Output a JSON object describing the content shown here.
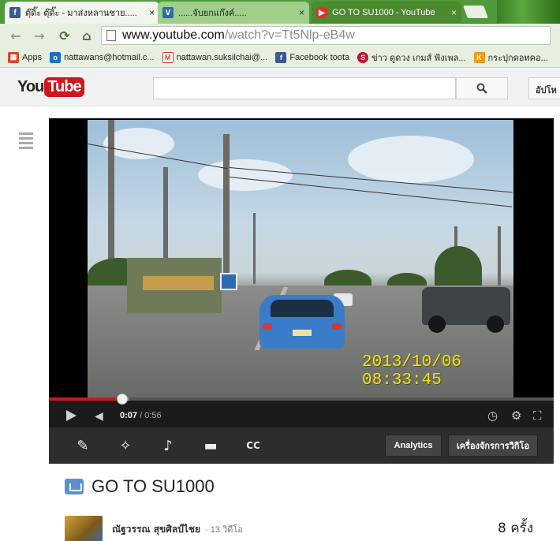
{
  "browser": {
    "tabs": [
      {
        "title": "ตุ๊ดิ๊ะ ตุ๊ดิ๊ะ - มาส่งหลานชาย.....",
        "favicon": "facebook-icon",
        "close": "×"
      },
      {
        "title": "......จับยกแก๊งค์.....",
        "favicon": "site-icon",
        "close": "×"
      },
      {
        "title": "GO TO SU1000 - YouTube",
        "favicon": "youtube-icon",
        "close": "×"
      }
    ],
    "url_host": "www.youtube.com",
    "url_rest": "/watch?v=Tt5Nlp-eB4w",
    "bookmarks": [
      {
        "label": "Apps",
        "icon": "apps-icon",
        "color": "#d9482b"
      },
      {
        "label": "nattawans@hotmail.c...",
        "icon": "outlook-icon",
        "color": "#1f6fc5"
      },
      {
        "label": "nattawan.suksilchai@...",
        "icon": "gmail-icon",
        "color": "#d23f31"
      },
      {
        "label": "Facebook toota",
        "icon": "facebook-icon",
        "color": "#3b5998"
      },
      {
        "label": "ข่าว ดูดวง เกมส์ ฟังเพล...",
        "icon": "sanook-icon",
        "color": "#c8102e"
      },
      {
        "label": "กระปุกดอทคอ...",
        "icon": "kapook-icon",
        "color": "#f39c12"
      }
    ]
  },
  "youtube": {
    "logo_you": "You",
    "logo_tube": "Tube",
    "search_placeholder": "",
    "upload_label": "อัปโห"
  },
  "player": {
    "timestamp_date": "2013/10/06",
    "timestamp_time": "08:33:45",
    "current_time": "0:07",
    "duration": "/ 0:56",
    "progress": 0.145,
    "buffered": 0.16
  },
  "editbar": {
    "analytics_label": "Analytics",
    "tools_label": "เครื่องจักรการวิกิโอ"
  },
  "video_info": {
    "title": "GO TO SU1000",
    "owner": "ณัฐวรรณ สุขศิลป์ไชย",
    "video_count": "· 13 วิดีโอ",
    "views": "8 ครั้ง"
  }
}
